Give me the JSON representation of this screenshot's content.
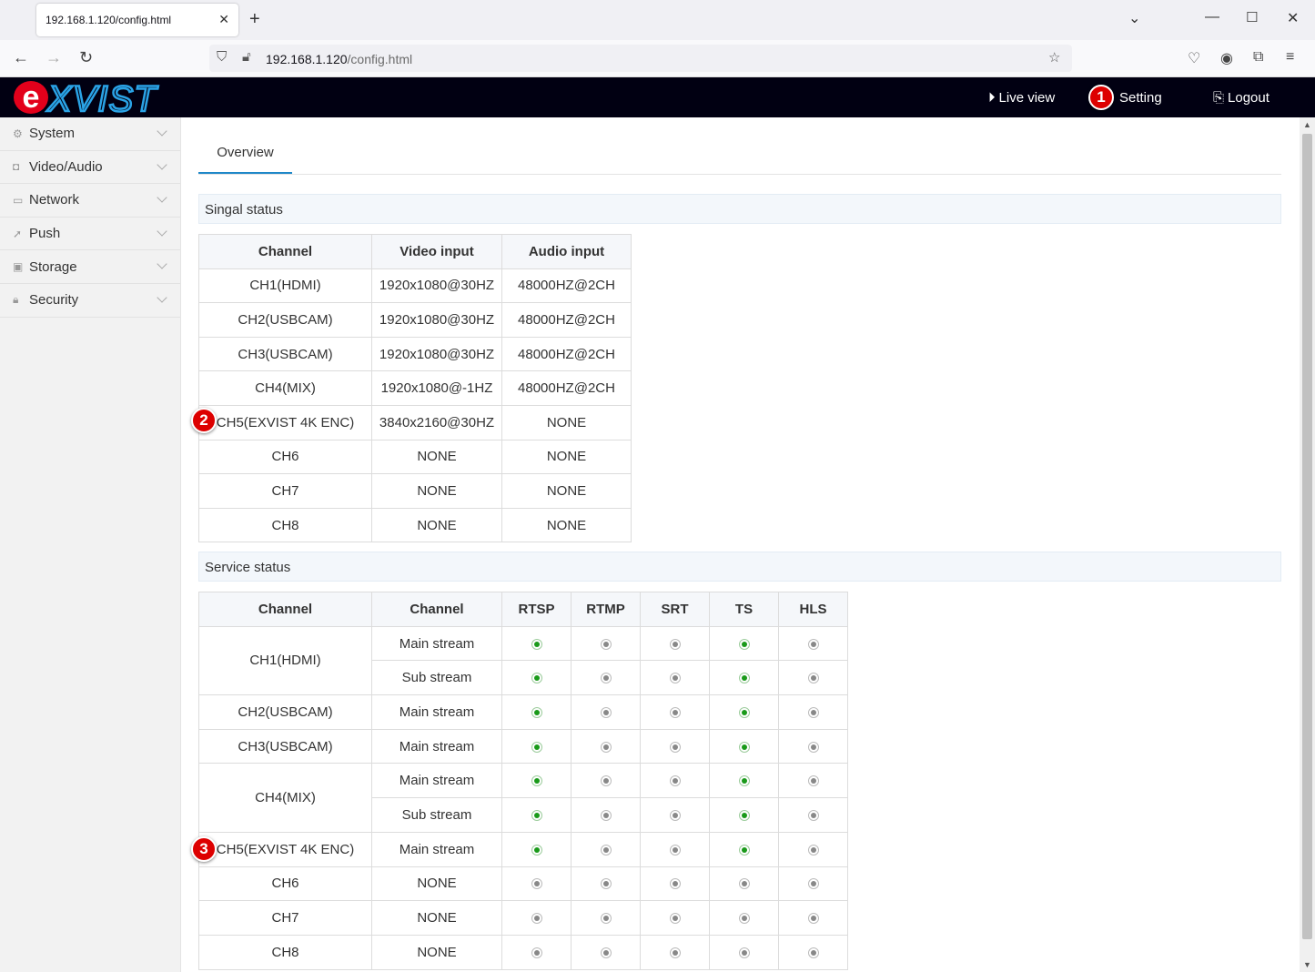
{
  "browser": {
    "tab_title": "192.168.1.120/config.html",
    "url_host": "192.168.1.120",
    "url_path": "/config.html"
  },
  "header": {
    "logo_text": "eXVIST",
    "live_view": "Live view",
    "setting": "Setting",
    "logout": "Logout",
    "badges": [
      "1",
      "2",
      "3"
    ]
  },
  "sidebar": {
    "items": [
      {
        "label": "System",
        "icon": "gear-icon"
      },
      {
        "label": "Video/Audio",
        "icon": "camera-icon"
      },
      {
        "label": "Network",
        "icon": "monitor-icon"
      },
      {
        "label": "Push",
        "icon": "send-icon"
      },
      {
        "label": "Storage",
        "icon": "disk-icon"
      },
      {
        "label": "Security",
        "icon": "lock-icon"
      }
    ]
  },
  "main": {
    "tab_overview": "Overview",
    "signal_title": "Singal status",
    "service_title": "Service status"
  },
  "signal_table": {
    "headers": [
      "Channel",
      "Video input",
      "Audio input"
    ],
    "rows": [
      [
        "CH1(HDMI)",
        "1920x1080@30HZ",
        "48000HZ@2CH"
      ],
      [
        "CH2(USBCAM)",
        "1920x1080@30HZ",
        "48000HZ@2CH"
      ],
      [
        "CH3(USBCAM)",
        "1920x1080@30HZ",
        "48000HZ@2CH"
      ],
      [
        "CH4(MIX)",
        "1920x1080@-1HZ",
        "48000HZ@2CH"
      ],
      [
        "CH5(EXVIST 4K ENC)",
        "3840x2160@30HZ",
        "NONE"
      ],
      [
        "CH6",
        "NONE",
        "NONE"
      ],
      [
        "CH7",
        "NONE",
        "NONE"
      ],
      [
        "CH8",
        "NONE",
        "NONE"
      ]
    ]
  },
  "service_table": {
    "headers": [
      "Channel",
      "Channel",
      "RTSP",
      "RTMP",
      "SRT",
      "TS",
      "HLS"
    ],
    "groups": [
      {
        "channel": "CH1(HDMI)",
        "streams": [
          {
            "name": "Main stream",
            "status": [
              1,
              0,
              0,
              1,
              0
            ]
          },
          {
            "name": "Sub stream",
            "status": [
              1,
              0,
              0,
              1,
              0
            ]
          }
        ]
      },
      {
        "channel": "CH2(USBCAM)",
        "streams": [
          {
            "name": "Main stream",
            "status": [
              1,
              0,
              0,
              1,
              0
            ]
          }
        ]
      },
      {
        "channel": "CH3(USBCAM)",
        "streams": [
          {
            "name": "Main stream",
            "status": [
              1,
              0,
              0,
              1,
              0
            ]
          }
        ]
      },
      {
        "channel": "CH4(MIX)",
        "streams": [
          {
            "name": "Main stream",
            "status": [
              1,
              0,
              0,
              1,
              0
            ]
          },
          {
            "name": "Sub stream",
            "status": [
              1,
              0,
              0,
              1,
              0
            ]
          }
        ]
      },
      {
        "channel": "CH5(EXVIST 4K ENC)",
        "streams": [
          {
            "name": "Main stream",
            "status": [
              1,
              0,
              0,
              1,
              0
            ]
          }
        ]
      },
      {
        "channel": "CH6",
        "streams": [
          {
            "name": "NONE",
            "status": [
              0,
              0,
              0,
              0,
              0
            ]
          }
        ]
      },
      {
        "channel": "CH7",
        "streams": [
          {
            "name": "NONE",
            "status": [
              0,
              0,
              0,
              0,
              0
            ]
          }
        ]
      },
      {
        "channel": "CH8",
        "streams": [
          {
            "name": "NONE",
            "status": [
              0,
              0,
              0,
              0,
              0
            ]
          }
        ]
      }
    ]
  },
  "colors": {
    "header_bg": "#010012",
    "accent": "#1e88c8",
    "status_on": "#1a9a1a",
    "status_off": "#888888",
    "badge": "#dd0000"
  }
}
